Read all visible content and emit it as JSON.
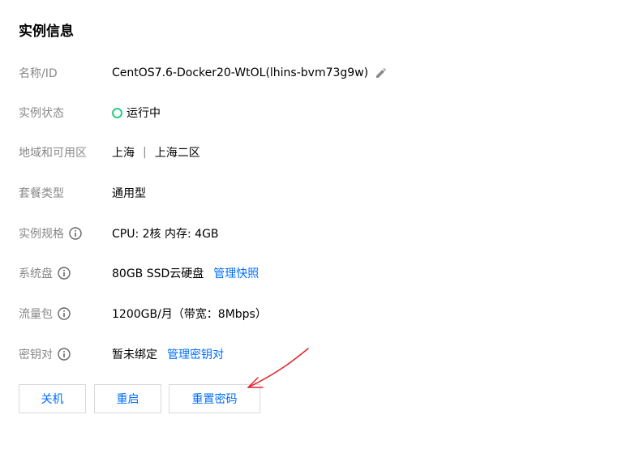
{
  "section_title": "实例信息",
  "rows": {
    "name_id": {
      "label": "名称/ID",
      "value": "CentOS7.6-Docker20-WtOL(lhins-bvm73g9w)",
      "icon": "edit-icon"
    },
    "status": {
      "label": "实例状态",
      "value": "运行中",
      "status_color": "#29cc85"
    },
    "region": {
      "label": "地域和可用区",
      "region": "上海",
      "separator": "|",
      "zone": "上海二区"
    },
    "package_type": {
      "label": "套餐类型",
      "value": "通用型"
    },
    "spec": {
      "label": "实例规格",
      "value": "CPU: 2核 内存: 4GB",
      "icon": "info-icon"
    },
    "system_disk": {
      "label": "系统盘",
      "value": "80GB SSD云硬盘",
      "link": "管理快照",
      "icon": "info-icon"
    },
    "traffic": {
      "label": "流量包",
      "value": "1200GB/月（带宽：8Mbps）",
      "icon": "info-icon"
    },
    "key_pair": {
      "label": "密钥对",
      "value": "暂未绑定",
      "link": "管理密钥对",
      "icon": "info-icon"
    }
  },
  "buttons": {
    "shutdown": "关机",
    "restart": "重启",
    "reset_password": "重置密码"
  },
  "colors": {
    "link": "#006eff",
    "label": "#888888",
    "annotation_arrow": "#e0242b"
  }
}
